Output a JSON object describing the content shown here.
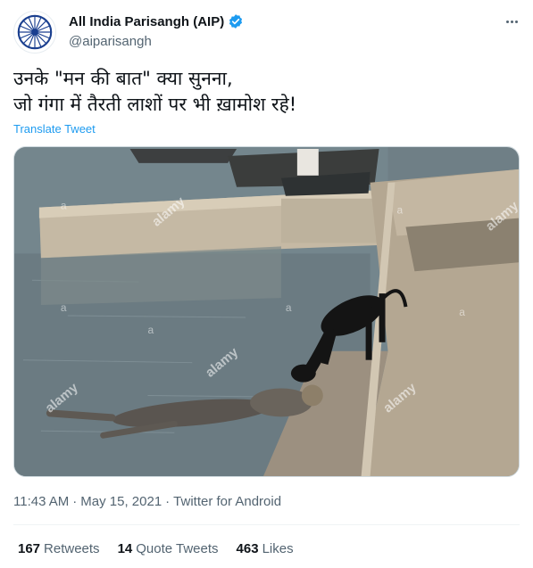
{
  "author": {
    "display_name": "All India Parisangh (AIP)",
    "handle": "@aiparisangh",
    "verified": true,
    "avatar_icon": "ashoka-chakra-logo-icon"
  },
  "tweet": {
    "text_line1": "उनके \"मन की बात\" क्या सुनना,",
    "text_line2": "जो गंगा में तैरती लाशों पर भी ख़ामोश रहे!",
    "translate_label": "Translate Tweet"
  },
  "media": {
    "watermark": "alamy",
    "watermark_short": "a"
  },
  "meta": {
    "time": "11:43 AM",
    "separator": "·",
    "date": "May 15, 2021",
    "source": "Twitter for Android"
  },
  "stats": {
    "retweets_count": "167",
    "retweets_label": "Retweets",
    "quotes_count": "14",
    "quotes_label": "Quote Tweets",
    "likes_count": "463",
    "likes_label": "Likes"
  },
  "colors": {
    "accent": "#1d9bf0",
    "text": "#0f1419",
    "secondary": "#536471"
  },
  "icons": [
    "verified-badge-icon",
    "more-options-icon",
    "ashoka-chakra-logo-icon"
  ]
}
